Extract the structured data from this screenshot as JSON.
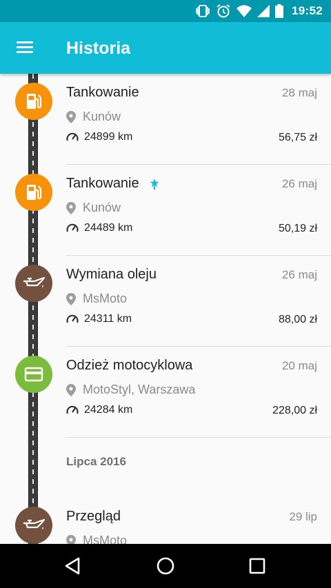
{
  "status_bar": {
    "time": "19:52"
  },
  "app_bar": {
    "title": "Historia"
  },
  "entries": [
    {
      "title": "Tankowanie",
      "date": "28 maj",
      "location": "Kunów",
      "km": "24899 km",
      "price": "56,75 zł",
      "icon": "fuel-pump-icon",
      "color": "#f7930a"
    },
    {
      "title": "Tankowanie",
      "date": "26 maj",
      "location": "Kunów",
      "km": "24489 km",
      "price": "50,19 zł",
      "icon": "fuel-pump-icon",
      "color": "#f7930a",
      "badge": "full-tank-icon"
    },
    {
      "title": "Wymiana oleju",
      "date": "26 maj",
      "location": "MsMoto",
      "km": "24311 km",
      "price": "88,00 zł",
      "icon": "oil-can-icon",
      "color": "#74503f"
    },
    {
      "title": "Odzież motocyklowa",
      "date": "20 maj",
      "location": "MotoStyl, Warszawa",
      "km": "24284 km",
      "price": "228,00 zł",
      "icon": "card-icon",
      "color": "#7cbc3c"
    }
  ],
  "section": {
    "label": "Lipca 2016"
  },
  "next_entry": {
    "title": "Przegląd",
    "date": "29 lip",
    "location": "MsMoto",
    "icon": "oil-can-icon",
    "color": "#74503f"
  },
  "colors": {
    "status_bar": "#0098ad",
    "app_bar": "#11bcd6",
    "accent": "#11bcd6"
  }
}
